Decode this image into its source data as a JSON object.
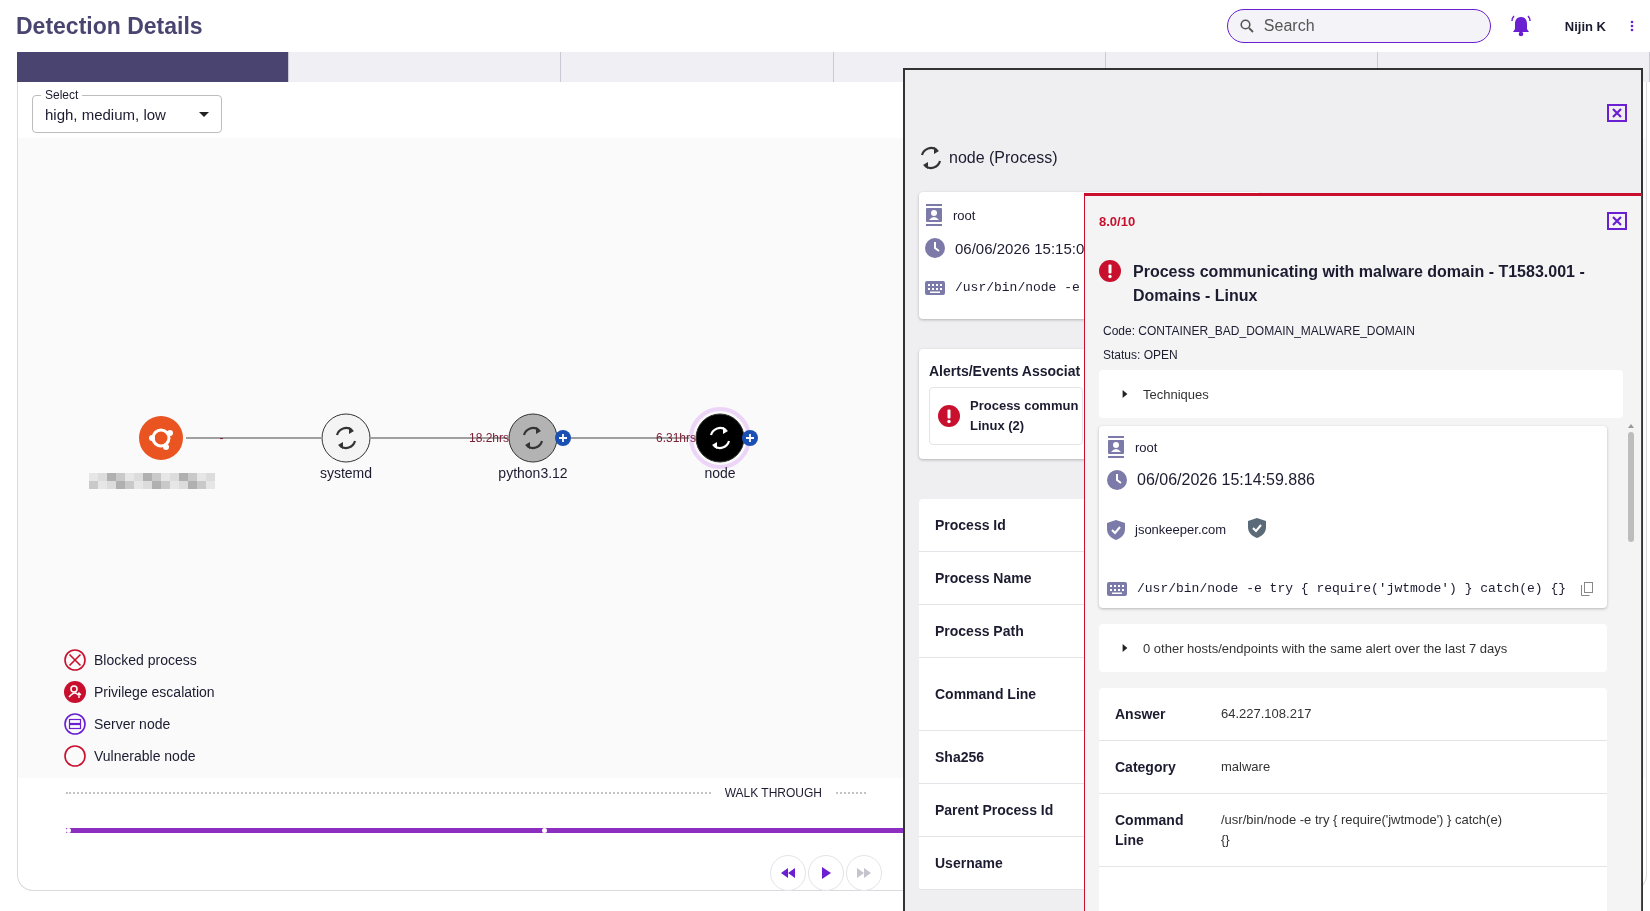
{
  "header": {
    "title": "Detection Details",
    "search": {
      "placeholder": "Search"
    },
    "user": "Nijin K"
  },
  "tabs": [
    {
      "selected": true
    },
    {
      "selected": false
    },
    {
      "selected": false
    },
    {
      "selected": false
    },
    {
      "selected": false
    },
    {
      "selected": false
    }
  ],
  "filter": {
    "label": "Select",
    "value": "high, medium, low"
  },
  "graph": {
    "nodes": [
      {
        "kind": "host",
        "color": "#e95420",
        "selected": false,
        "expandable": false
      },
      {
        "kind": "process",
        "label": "systemd",
        "edge_label": "-",
        "color": "#f4f4f4",
        "selected": false,
        "expandable": false
      },
      {
        "kind": "process",
        "label": "python3.12",
        "edge_label": "18.2hrs",
        "color": "#b3b3b3",
        "selected": false,
        "expandable": true
      },
      {
        "kind": "process",
        "label": "node",
        "edge_label": "6.31hrs",
        "color": "#000000",
        "selected": true,
        "expandable": true
      }
    ]
  },
  "legend": [
    {
      "kind": "blocked",
      "label": "Blocked process"
    },
    {
      "kind": "privilege",
      "label": "Privilege escalation"
    },
    {
      "kind": "server",
      "label": "Server node"
    },
    {
      "kind": "vulnerable",
      "label": "Vulnerable node"
    }
  ],
  "walkthrough": {
    "label": "WALK THROUGH",
    "controls": [
      {
        "kind": "rewind",
        "disabled": false
      },
      {
        "kind": "play",
        "disabled": false
      },
      {
        "kind": "forward",
        "disabled": true
      }
    ]
  },
  "process_panel": {
    "title": "node (Process)",
    "user": "root",
    "time": "06/06/2026 15:15:0",
    "command": "/usr/bin/node -e",
    "alerts_title": "Alerts/Events Associat",
    "alert_lines": [
      "Process commun",
      "Linux (2)"
    ],
    "details": [
      "Process Id",
      "Process Name",
      "Process Path",
      "Command Line",
      "Sha256",
      "Parent Process Id",
      "Username"
    ]
  },
  "alert_panel": {
    "score": "8.0/10",
    "title": "Process communicating with malware domain - T1583.001 - Domains - Linux",
    "code": "Code: CONTAINER_BAD_DOMAIN_MALWARE_DOMAIN",
    "status": "Status: OPEN",
    "techniques": {
      "label": "Techniques",
      "expanded": false
    },
    "info": {
      "user": "root",
      "time": "06/06/2026 15:14:59.886",
      "domain": "jsonkeeper.com",
      "verified": true,
      "command": "/usr/bin/node -e try { require('jwtmode') } catch(e) {}"
    },
    "other_hosts": {
      "label": "0 other hosts/endpoints with the same alert over the last 7 days",
      "expanded": false
    },
    "rows": [
      {
        "label": "Answer",
        "value": "64.227.108.217"
      },
      {
        "label": "Category",
        "value": "malware"
      },
      {
        "label": "Command Line",
        "value": "/usr/bin/node -e try { require('jwtmode') } catch(e) {}"
      }
    ]
  }
}
